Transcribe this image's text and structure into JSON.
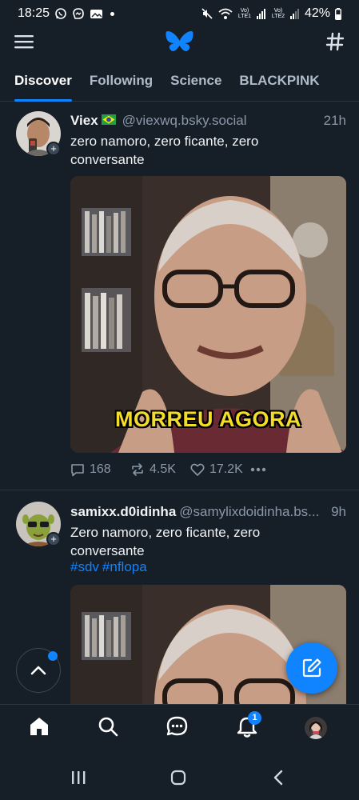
{
  "status_bar": {
    "time": "18:25",
    "signal1_label": "Vo) LTE1",
    "signal2_label": "Vo) LTE2",
    "battery": "42%",
    "icons": [
      "whatsapp-icon",
      "messenger-icon",
      "gallery-icon",
      "mute-icon",
      "wifi-icon",
      "signal-icon",
      "battery-icon"
    ]
  },
  "header": {
    "menu_icon": "menu-icon",
    "logo_icon": "bluesky-butterfly-icon",
    "feeds_icon": "hashtag-icon"
  },
  "tabs": [
    {
      "label": "Discover",
      "active": true
    },
    {
      "label": "Following",
      "active": false
    },
    {
      "label": "Science",
      "active": false
    },
    {
      "label": "BLACKPINK",
      "active": false
    }
  ],
  "posts": [
    {
      "author": "Viex",
      "flag": "brazil-flag-icon",
      "handle": "@viexwq.bsky.social",
      "time": "21h",
      "text": "zero namoro, zero ficante, zero conversante",
      "media_caption": "MORREU AGORA",
      "replies": "168",
      "reposts": "4.5K",
      "likes": "17.2K"
    },
    {
      "author": "samixx.d0idinha",
      "handle": "@samylixdoidinha.bs...",
      "time": "9h",
      "text": "Zero namoro, zero ficante, zero conversante",
      "tags": [
        "#sdv",
        "#nflopa"
      ]
    }
  ],
  "bottom_nav": {
    "items": [
      "home-icon",
      "search-icon",
      "chat-icon",
      "notifications-icon",
      "profile-avatar"
    ],
    "notification_count": "1"
  },
  "colors": {
    "background": "#161e27",
    "accent": "#1083fe",
    "muted": "#8a98a8",
    "caption": "#f4dd26"
  }
}
